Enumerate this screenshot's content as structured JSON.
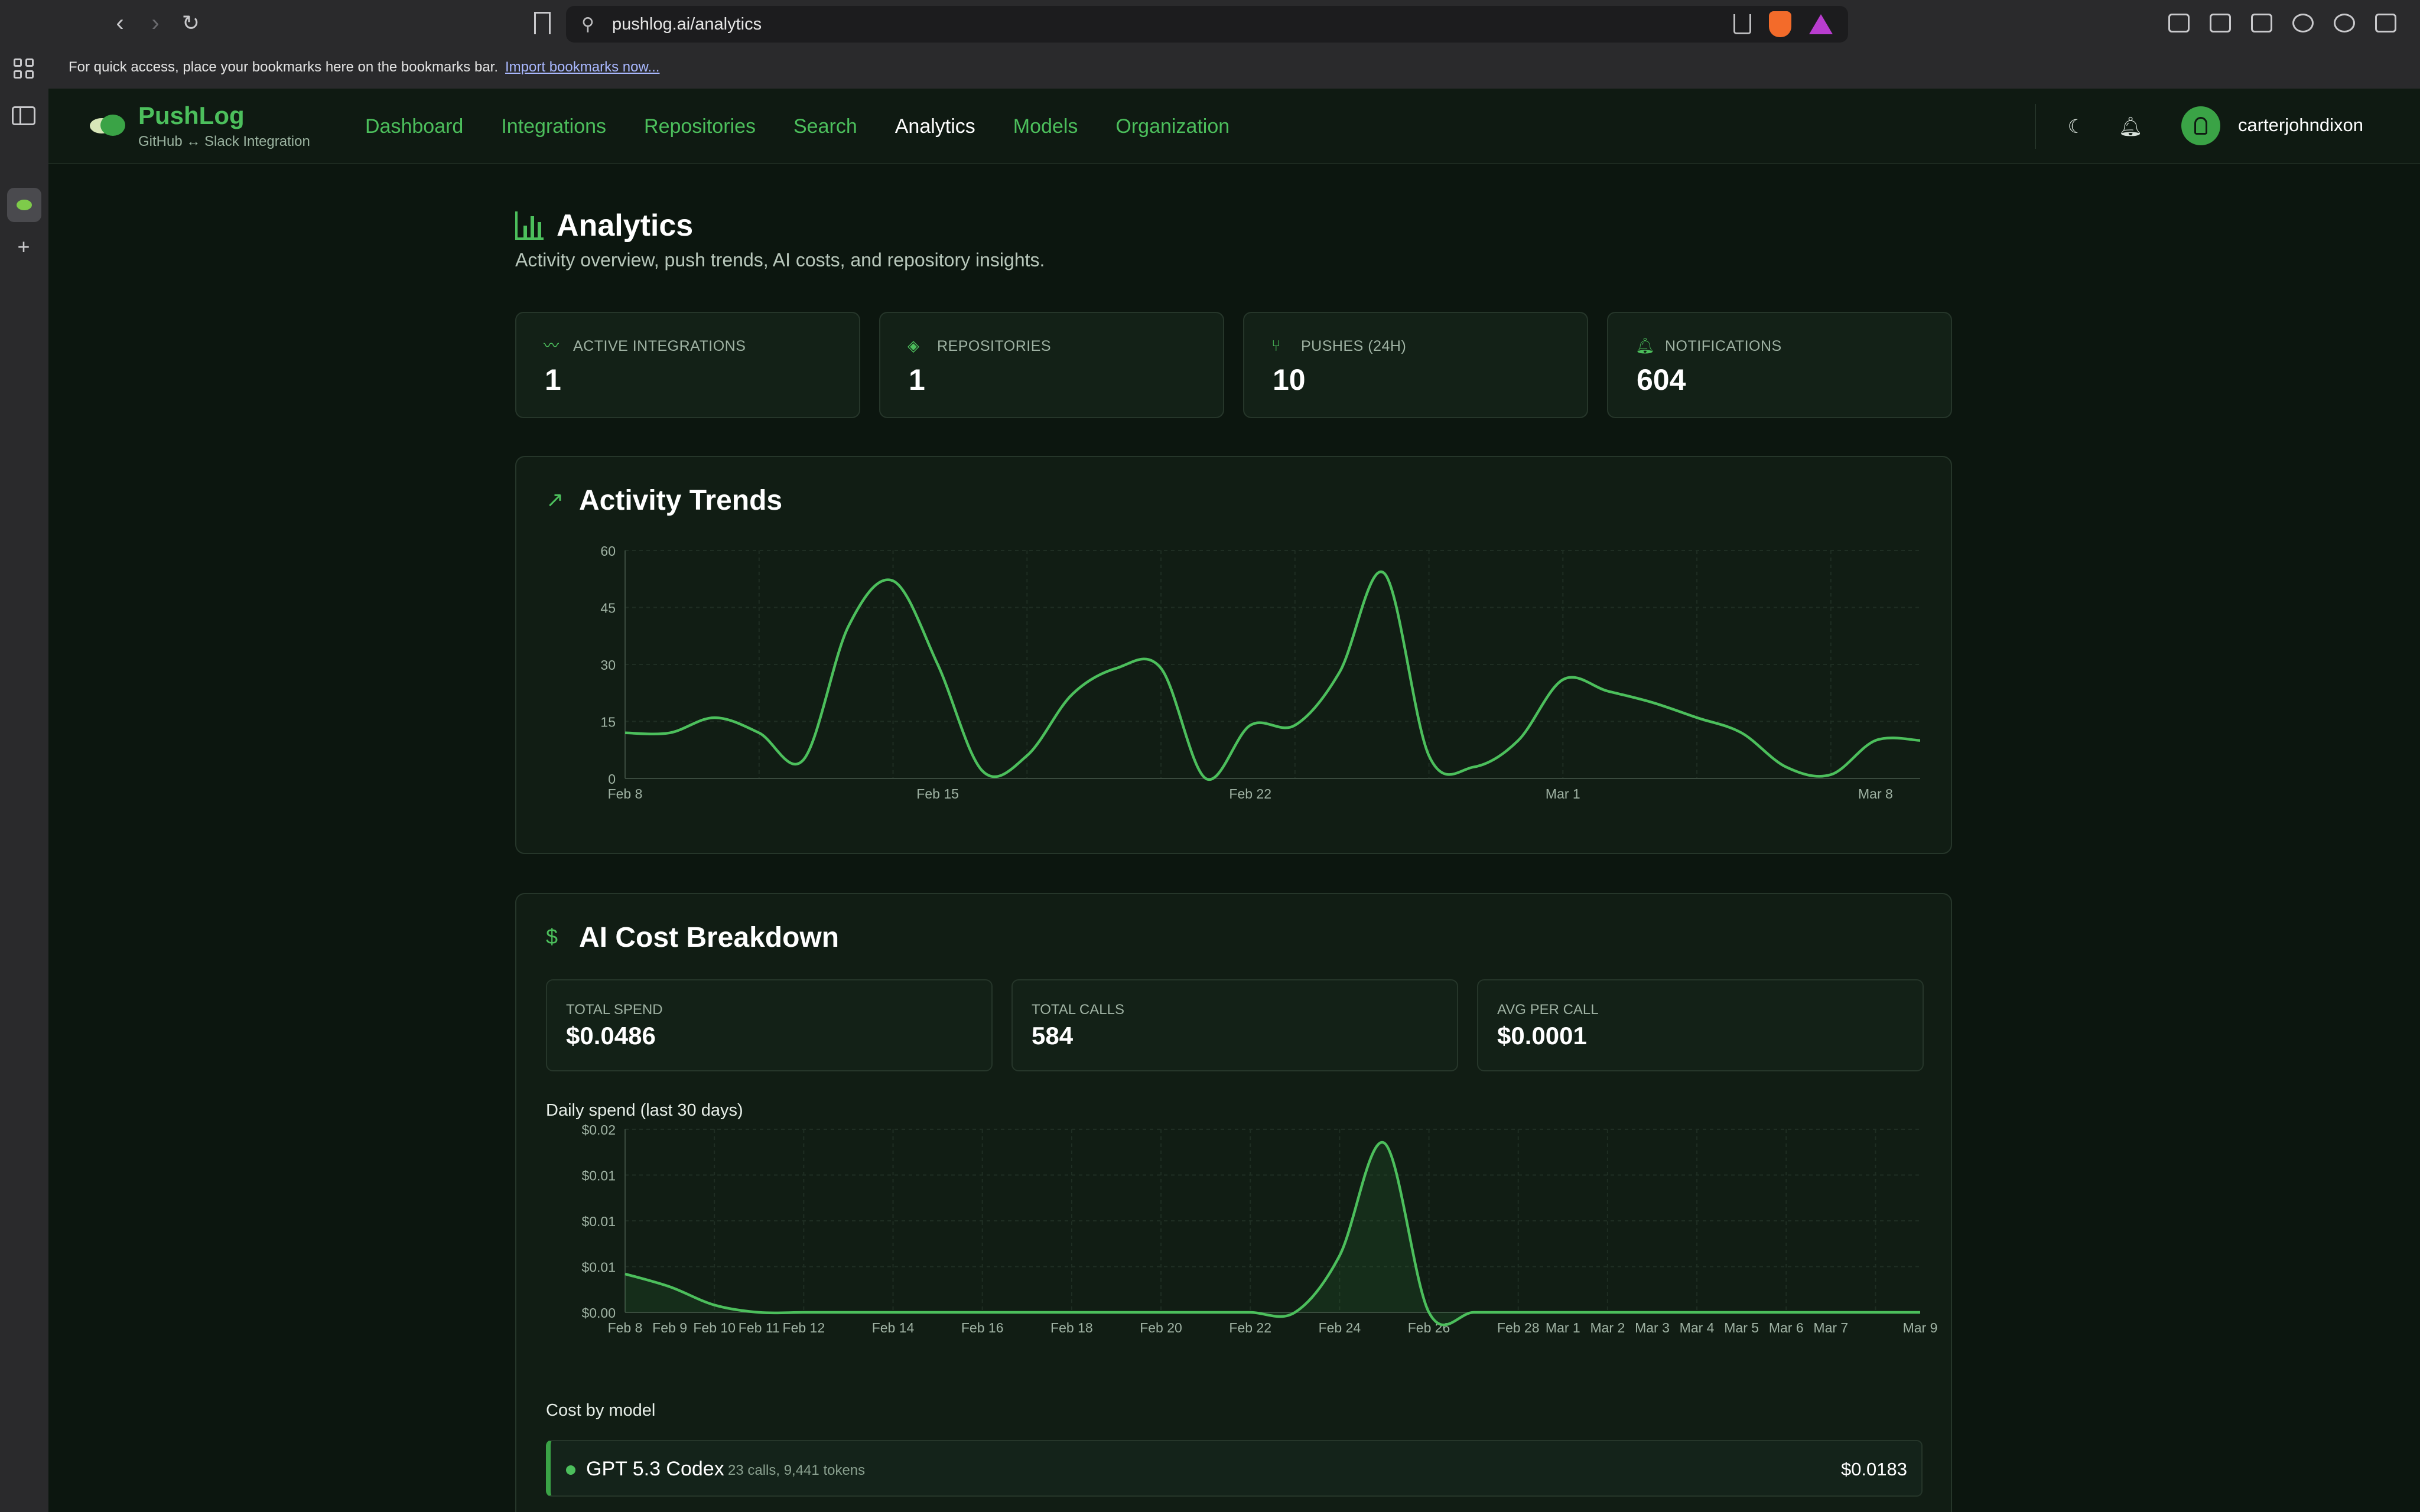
{
  "browser": {
    "url": "pushlog.ai/analytics",
    "bookmarks_text": "For quick access, place your bookmarks here on the bookmarks bar.",
    "bookmarks_link": "Import bookmarks now..."
  },
  "brand": {
    "name": "PushLog",
    "subtitle": "GitHub ↔ Slack Integration"
  },
  "nav": {
    "links": [
      "Dashboard",
      "Integrations",
      "Repositories",
      "Search",
      "Analytics",
      "Models",
      "Organization"
    ],
    "active": "Analytics",
    "username": "carterjohndixon"
  },
  "page": {
    "title": "Analytics",
    "subtitle": "Activity overview, push trends, AI costs, and repository insights."
  },
  "stats": [
    {
      "label": "ACTIVE INTEGRATIONS",
      "value": "1",
      "icon": "activity-icon"
    },
    {
      "label": "REPOSITORIES",
      "value": "1",
      "icon": "layers-icon"
    },
    {
      "label": "PUSHES (24H)",
      "value": "10",
      "icon": "git-branch-icon"
    },
    {
      "label": "NOTIFICATIONS",
      "value": "604",
      "icon": "bell-icon"
    }
  ],
  "activity": {
    "title": "Activity Trends"
  },
  "cost": {
    "title": "AI Cost Breakdown",
    "cards": [
      {
        "label": "TOTAL SPEND",
        "value": "$0.0486"
      },
      {
        "label": "TOTAL CALLS",
        "value": "584"
      },
      {
        "label": "AVG PER CALL",
        "value": "$0.0001"
      }
    ],
    "daily_label": "Daily spend (last 30 days)",
    "by_model_label": "Cost by model",
    "models": [
      {
        "name": "GPT 5.3 Codex",
        "meta": "23 calls, 9,441 tokens",
        "cost": "$0.0183"
      }
    ]
  },
  "colors": {
    "accent": "#4cbf5c",
    "background": "#0c160f",
    "card": "#132117",
    "border": "#26362a"
  },
  "chart_data": [
    {
      "type": "line",
      "xlabel": "",
      "ylabel": "",
      "x_ticks": [
        "Feb 8",
        "Feb 15",
        "Feb 22",
        "Mar 1",
        "Mar 8"
      ],
      "y_ticks": [
        "0",
        "15",
        "30",
        "45",
        "60"
      ],
      "ylim": [
        0,
        60
      ],
      "grid": true,
      "x": [
        "Feb 8",
        "Feb 9",
        "Feb 10",
        "Feb 11",
        "Feb 12",
        "Feb 13",
        "Feb 14",
        "Feb 15",
        "Feb 16",
        "Feb 17",
        "Feb 18",
        "Feb 19",
        "Feb 20",
        "Feb 21",
        "Feb 22",
        "Feb 23",
        "Feb 24",
        "Feb 25",
        "Feb 26",
        "Feb 27",
        "Feb 28",
        "Mar 1",
        "Mar 2",
        "Mar 3",
        "Mar 4",
        "Mar 5",
        "Mar 6",
        "Mar 7",
        "Mar 8",
        "Mar 9"
      ],
      "series": [
        {
          "values": [
            12,
            12,
            16,
            12,
            5,
            40,
            52,
            30,
            2,
            6,
            22,
            29,
            29,
            0,
            14,
            14,
            28,
            54,
            6,
            3,
            10,
            26,
            23,
            20,
            16,
            12,
            3,
            1,
            10,
            10
          ]
        }
      ]
    },
    {
      "type": "area",
      "xlabel": "",
      "ylabel": "",
      "x_ticks": [
        "Feb 8",
        "Feb 9",
        "Feb 10",
        "Feb 11",
        "Feb 12",
        "Feb 14",
        "Feb 16",
        "Feb 18",
        "Feb 20",
        "Feb 22",
        "Feb 24",
        "Feb 26",
        "Feb 28",
        "Mar 1",
        "Mar 2",
        "Mar 3",
        "Mar 4",
        "Mar 5",
        "Mar 6",
        "Mar 7",
        "Mar 9"
      ],
      "y_ticks": [
        "$0.00",
        "$0.01",
        "$0.01",
        "$0.01",
        "$0.02"
      ],
      "ylim": [
        0,
        0.02
      ],
      "grid": true,
      "x": [
        "Feb 8",
        "Feb 9",
        "Feb 10",
        "Feb 11",
        "Feb 12",
        "Feb 13",
        "Feb 14",
        "Feb 15",
        "Feb 16",
        "Feb 17",
        "Feb 18",
        "Feb 19",
        "Feb 20",
        "Feb 21",
        "Feb 22",
        "Feb 23",
        "Feb 24",
        "Feb 25",
        "Feb 26",
        "Feb 27",
        "Feb 28",
        "Mar 1",
        "Mar 2",
        "Mar 3",
        "Mar 4",
        "Mar 5",
        "Mar 6",
        "Mar 7",
        "Mar 8",
        "Mar 9"
      ],
      "series": [
        {
          "values": [
            0.0042,
            0.0028,
            0.0008,
            0,
            0,
            0,
            0,
            0,
            0,
            0,
            0,
            0,
            0,
            0,
            0,
            0,
            0.0062,
            0.0185,
            0,
            0,
            0,
            0,
            0,
            0,
            0,
            0,
            0,
            0,
            0,
            0
          ]
        }
      ]
    }
  ]
}
